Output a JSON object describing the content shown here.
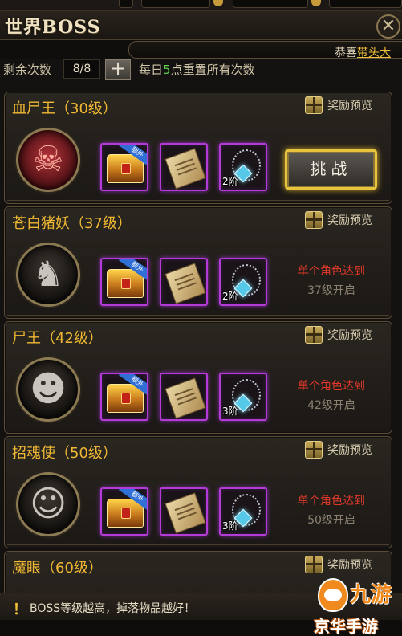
{
  "header": {
    "title": "世界BOSS",
    "close_icon": "close-icon"
  },
  "marquee": {
    "prefix": "恭喜",
    "highlight": "带头大"
  },
  "counter": {
    "label": "剩余次数",
    "value": "8/8",
    "plus": "+",
    "daily_prefix": "每日",
    "daily_num": "5",
    "daily_suffix": "点重置所有次数"
  },
  "bosses": [
    {
      "name": "血尸王（30级）",
      "preview": "奖励预览",
      "icon": "red-demon-face",
      "rewards": [
        {
          "type": "chest",
          "tag": "额外"
        },
        {
          "type": "scroll"
        },
        {
          "type": "necklace",
          "tier": "2阶"
        }
      ],
      "action": "挑战"
    },
    {
      "name": "苍白猪妖（37级）",
      "preview": "奖励预览",
      "icon": "boar-demon-face",
      "rewards": [
        {
          "type": "chest",
          "tag": "额外"
        },
        {
          "type": "scroll"
        },
        {
          "type": "necklace",
          "tier": "2阶"
        }
      ],
      "lock_line1": "单个角色达到",
      "lock_line2": "37级开启"
    },
    {
      "name": "尸王（42级）",
      "preview": "奖励预览",
      "icon": "orc-face",
      "rewards": [
        {
          "type": "chest",
          "tag": "额外"
        },
        {
          "type": "scroll"
        },
        {
          "type": "necklace",
          "tier": "3阶"
        }
      ],
      "lock_line1": "单个角色达到",
      "lock_line2": "42级开启"
    },
    {
      "name": "招魂使（50级）",
      "preview": "奖励预览",
      "icon": "goblin-face",
      "rewards": [
        {
          "type": "chest",
          "tag": "额外"
        },
        {
          "type": "scroll"
        },
        {
          "type": "necklace",
          "tier": "3阶"
        }
      ],
      "lock_line1": "单个角色达到",
      "lock_line2": "50级开启"
    },
    {
      "name": "魔眼（60级）",
      "preview": "奖励预览"
    }
  ],
  "footer": {
    "bang": "！",
    "tip": "BOSS等级越高，掉落物品越好！"
  },
  "watermark": {
    "brand": "九游",
    "site": "京华手游"
  },
  "colors": {
    "gold": "#f1b933",
    "purple_frame": "#b33cd6",
    "lock_red": "#e0382a",
    "green": "#5ed04a"
  }
}
